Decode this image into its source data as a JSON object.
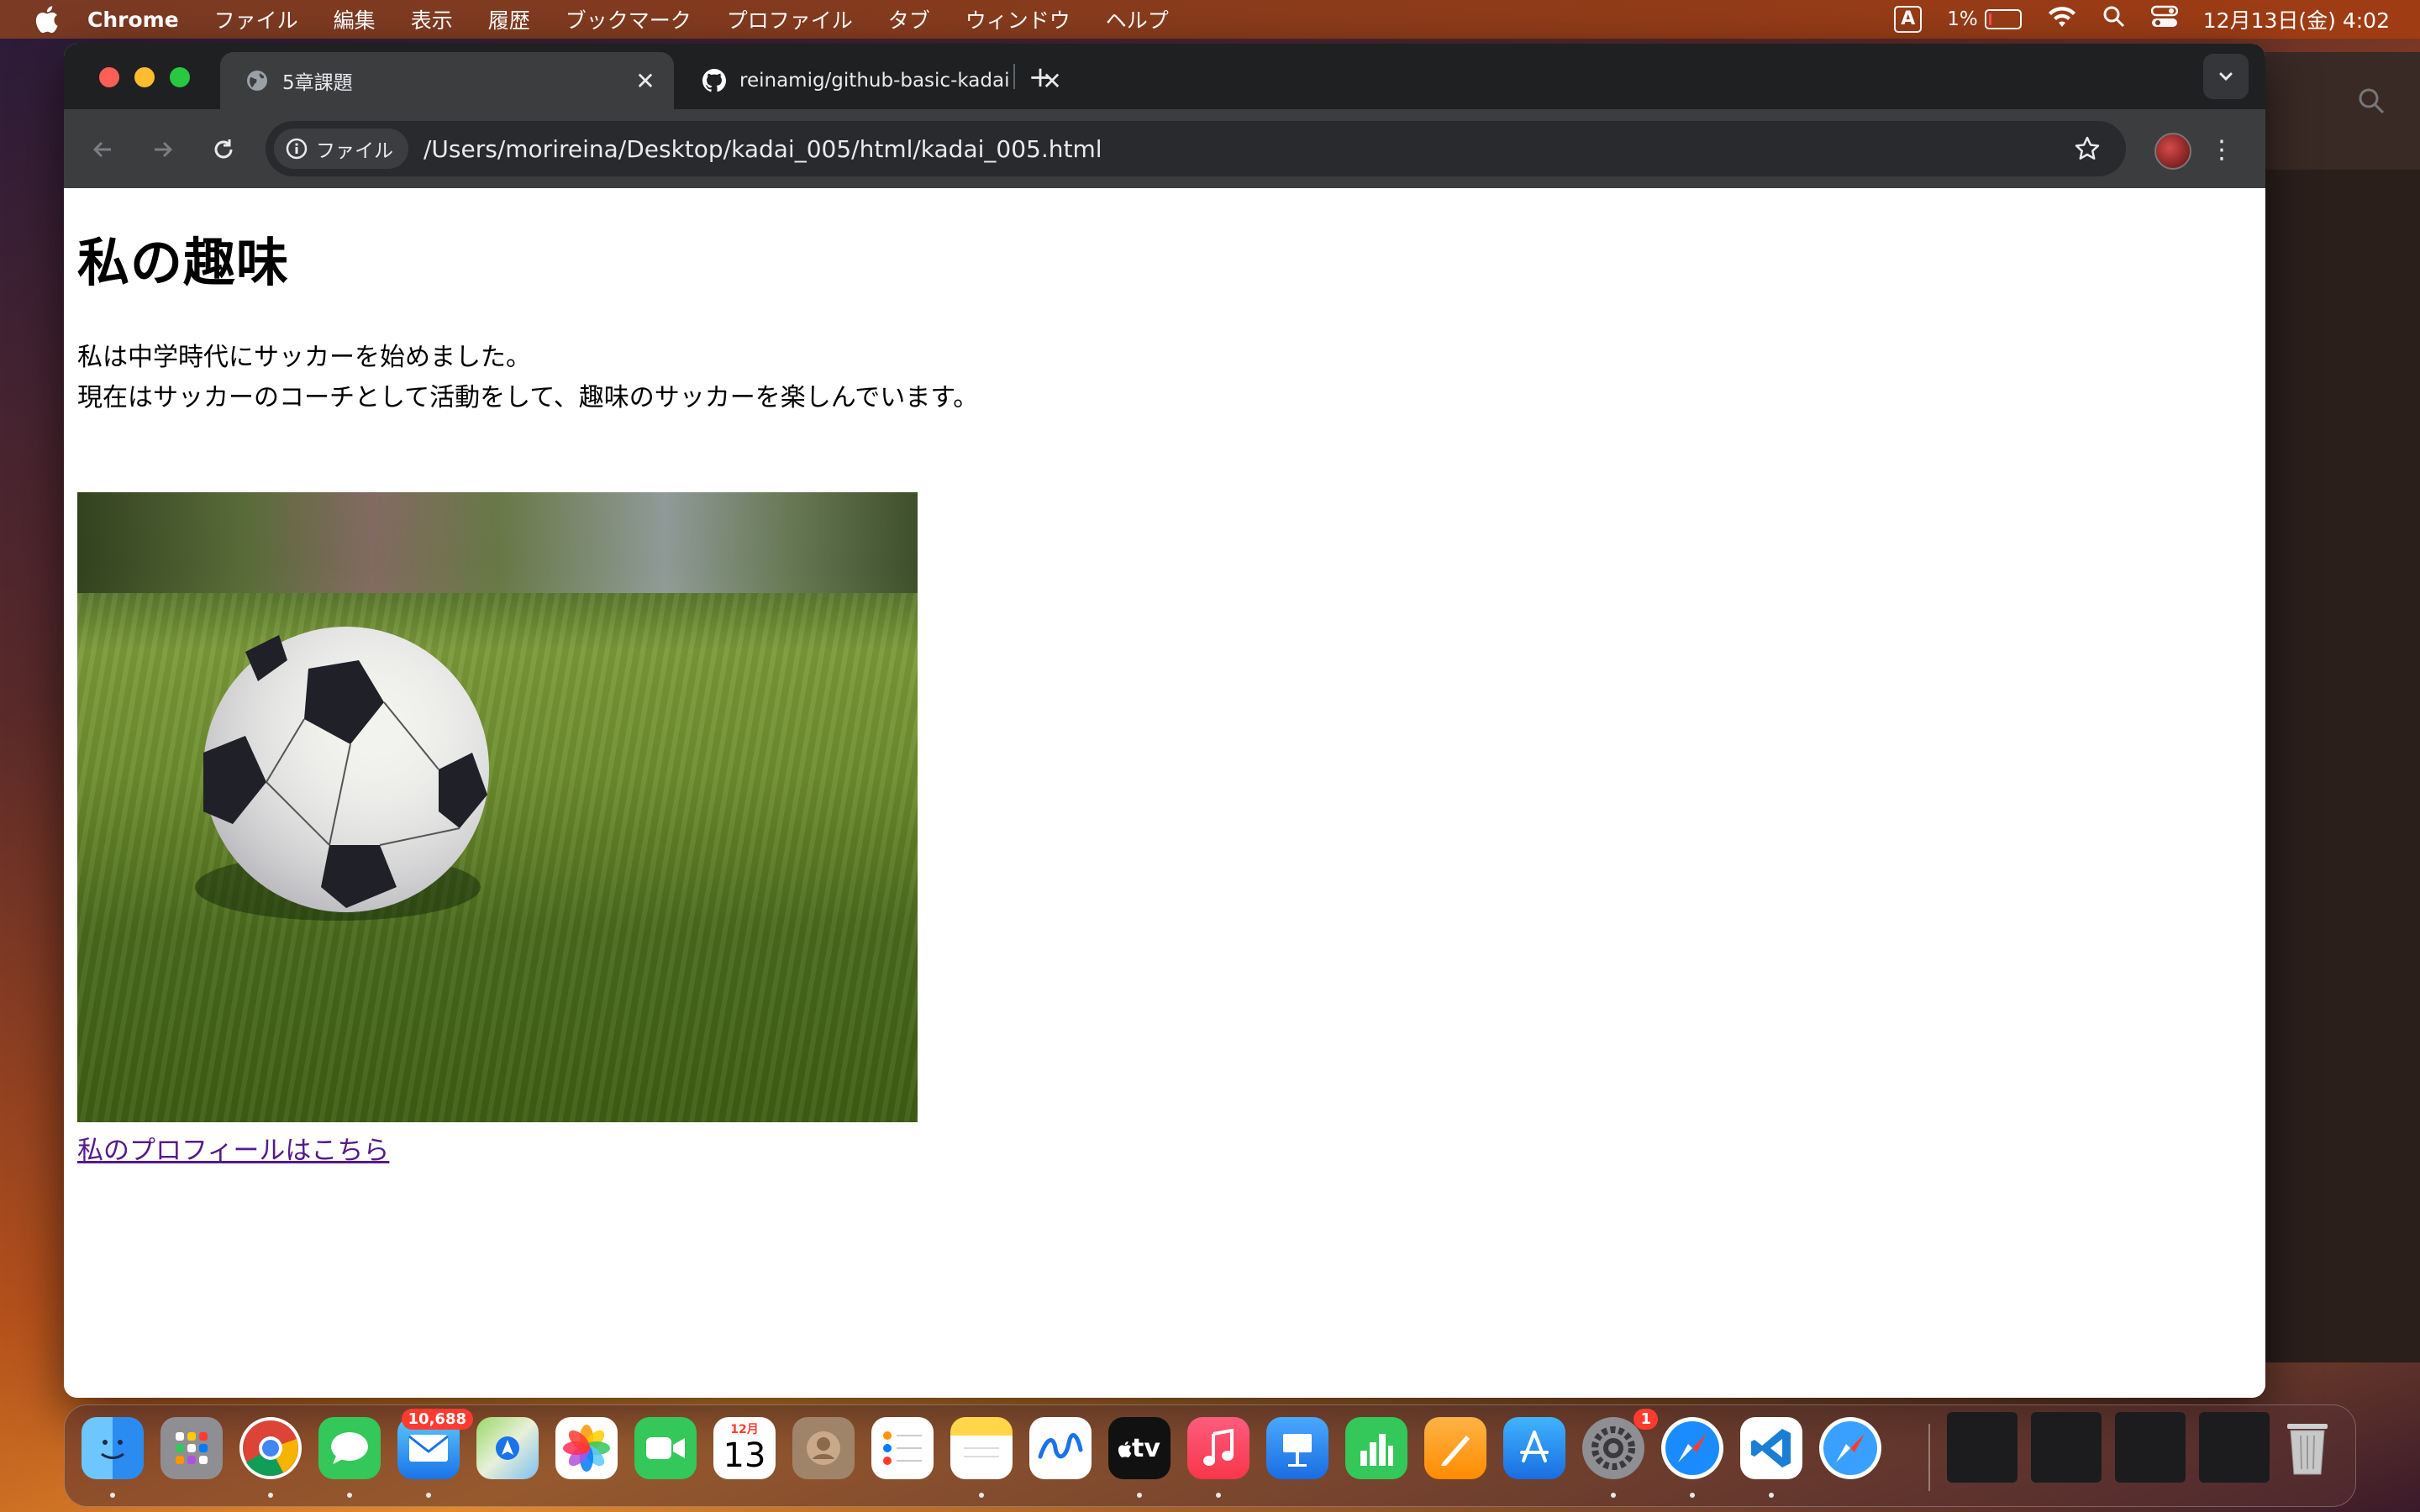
{
  "menubar": {
    "app_name": "Chrome",
    "items": [
      "ファイル",
      "編集",
      "表示",
      "履歴",
      "ブックマーク",
      "プロファイル",
      "タブ",
      "ウィンドウ",
      "ヘルプ"
    ],
    "input_indicator": "A",
    "battery_percent": "1%",
    "datetime": "12月13日(金) 4:02"
  },
  "browser": {
    "tabs": [
      {
        "title": "5章課題",
        "icon": "globe-icon",
        "active": true
      },
      {
        "title": "reinamig/github-basic-kadai",
        "icon": "github-icon",
        "active": false
      }
    ],
    "address": {
      "chip_label": "ファイル",
      "url": "/Users/morireina/Desktop/kadai_005/html/kadai_005.html"
    }
  },
  "page": {
    "heading": "私の趣味",
    "paragraph_lines": [
      "私は中学時代にサッカーを始めました。",
      "現在はサッカーのコーチとして活動をして、趣味のサッカーを楽しんでいます。"
    ],
    "link_text": "私のプロフィールはこちら"
  },
  "dock": {
    "apps": [
      "finder",
      "launchpad",
      "chrome",
      "messages",
      "mail",
      "maps",
      "photos",
      "facetime",
      "calendar",
      "contacts",
      "reminders",
      "notes",
      "freeform",
      "tv",
      "music",
      "keynote",
      "numbers",
      "pages",
      "app-store",
      "system-settings",
      "safari",
      "vscode",
      "safari-preview"
    ],
    "mail_badge": "10,688",
    "settings_badge": "1",
    "calendar_month": "12月",
    "calendar_day": "13",
    "tv_label": "tv"
  }
}
